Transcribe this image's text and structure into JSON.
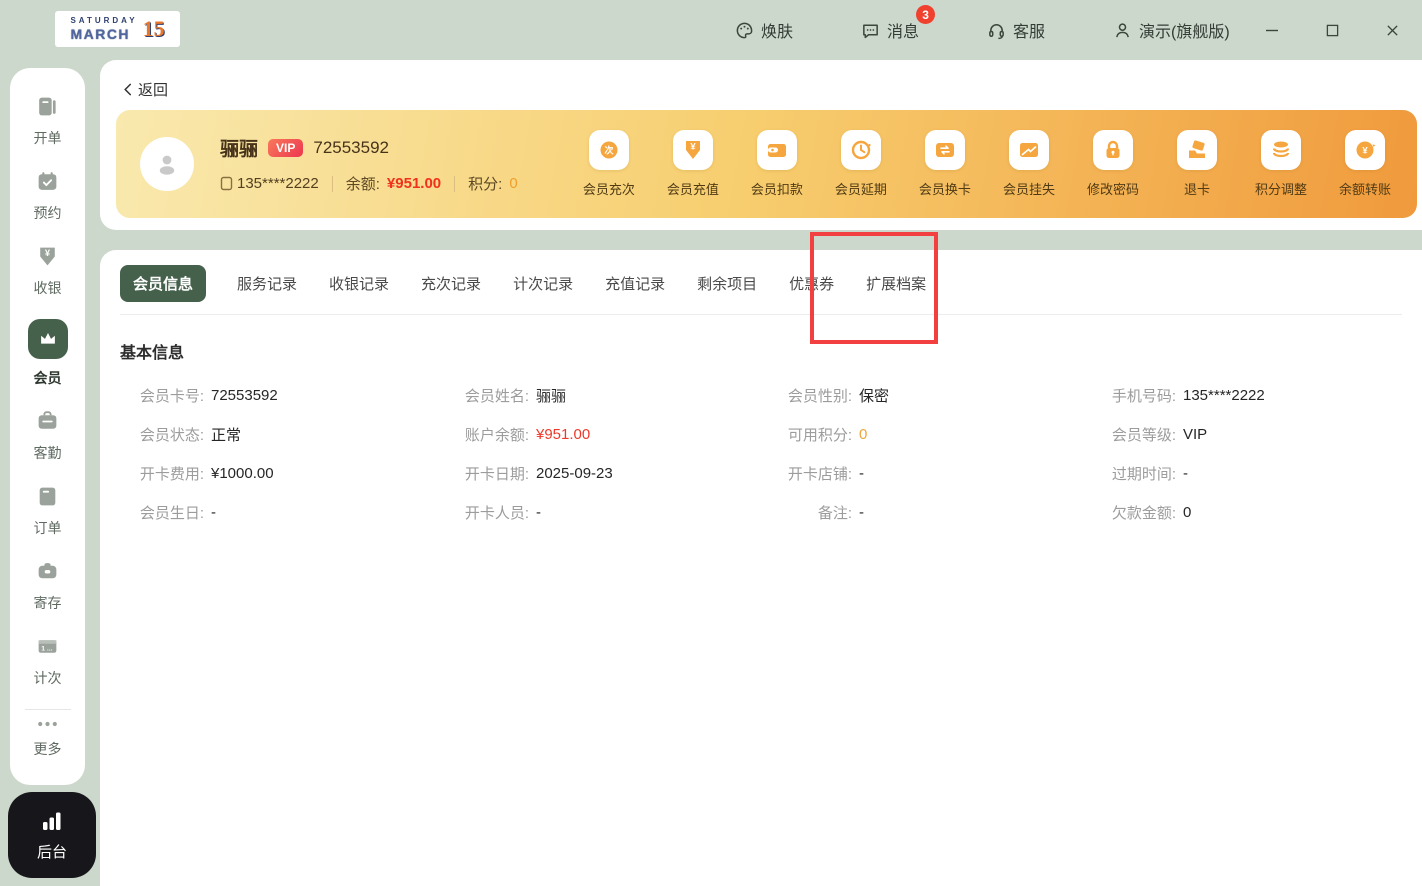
{
  "colors": {
    "background": "#ccd8cc",
    "accent_green": "#45614c",
    "card_gradient_start": "#f9e9ae",
    "card_gradient_end": "#f09a3c",
    "balance_red": "#f0321c",
    "points_orange": "#ef9f2e",
    "vip_badge_red": "#ed374f",
    "message_badge_red": "#f0402e",
    "highlight_box_red": "#f24040",
    "backend_black": "#17171b"
  },
  "topbar": {
    "logo": {
      "line1": "SATURDAY",
      "line2": "MARCH",
      "number": "15"
    },
    "nav": [
      {
        "label": "焕肤"
      },
      {
        "label": "消息",
        "badge": "3"
      },
      {
        "label": "客服"
      },
      {
        "label": "演示(旗舰版)"
      }
    ]
  },
  "sidebar": {
    "items": [
      {
        "label": "开单"
      },
      {
        "label": "预约"
      },
      {
        "label": "收银"
      },
      {
        "label": "会员",
        "active": true
      },
      {
        "label": "客勤"
      },
      {
        "label": "订单"
      },
      {
        "label": "寄存"
      },
      {
        "label": "计次"
      },
      {
        "label": "更多"
      }
    ],
    "backend_label": "后台"
  },
  "member_header": {
    "back_label": "返回",
    "name": "骊骊",
    "vip_badge": "VIP",
    "card_no": "72553592",
    "phone": "135****2222",
    "balance_label": "余额:",
    "balance_value": "¥951.00",
    "points_label": "积分:",
    "points_value": "0",
    "actions": [
      {
        "label": "会员充次"
      },
      {
        "label": "会员充值"
      },
      {
        "label": "会员扣款"
      },
      {
        "label": "会员延期"
      },
      {
        "label": "会员换卡"
      },
      {
        "label": "会员挂失"
      },
      {
        "label": "修改密码"
      },
      {
        "label": "退卡"
      },
      {
        "label": "积分调整"
      },
      {
        "label": "余额转账"
      }
    ]
  },
  "tabs": [
    {
      "label": "会员信息",
      "active": true
    },
    {
      "label": "服务记录"
    },
    {
      "label": "收银记录"
    },
    {
      "label": "充次记录"
    },
    {
      "label": "计次记录"
    },
    {
      "label": "充值记录"
    },
    {
      "label": "剩余项目"
    },
    {
      "label": "优惠券"
    },
    {
      "label": "扩展档案",
      "highlighted": true
    }
  ],
  "basic_info": {
    "title": "基本信息",
    "fields": [
      {
        "label": "会员卡号:",
        "value": "72553592"
      },
      {
        "label": "会员姓名:",
        "value": "骊骊"
      },
      {
        "label": "会员性别:",
        "value": "保密"
      },
      {
        "label": "手机号码:",
        "value": "135****2222"
      },
      {
        "label": "会员状态:",
        "value": "正常"
      },
      {
        "label": "账户余额:",
        "value": "¥951.00",
        "color": "red"
      },
      {
        "label": "可用积分:",
        "value": "0",
        "color": "orange"
      },
      {
        "label": "会员等级:",
        "value": "VIP"
      },
      {
        "label": "开卡费用:",
        "value": "¥1000.00"
      },
      {
        "label": "开卡日期:",
        "value": "2025-09-23"
      },
      {
        "label": "开卡店铺:",
        "value": "-"
      },
      {
        "label": "过期时间:",
        "value": "-"
      },
      {
        "label": "会员生日:",
        "value": "-"
      },
      {
        "label": "开卡人员:",
        "value": "-"
      },
      {
        "label": "备注:",
        "value": "-"
      },
      {
        "label": "欠款金额:",
        "value": "0"
      }
    ]
  }
}
